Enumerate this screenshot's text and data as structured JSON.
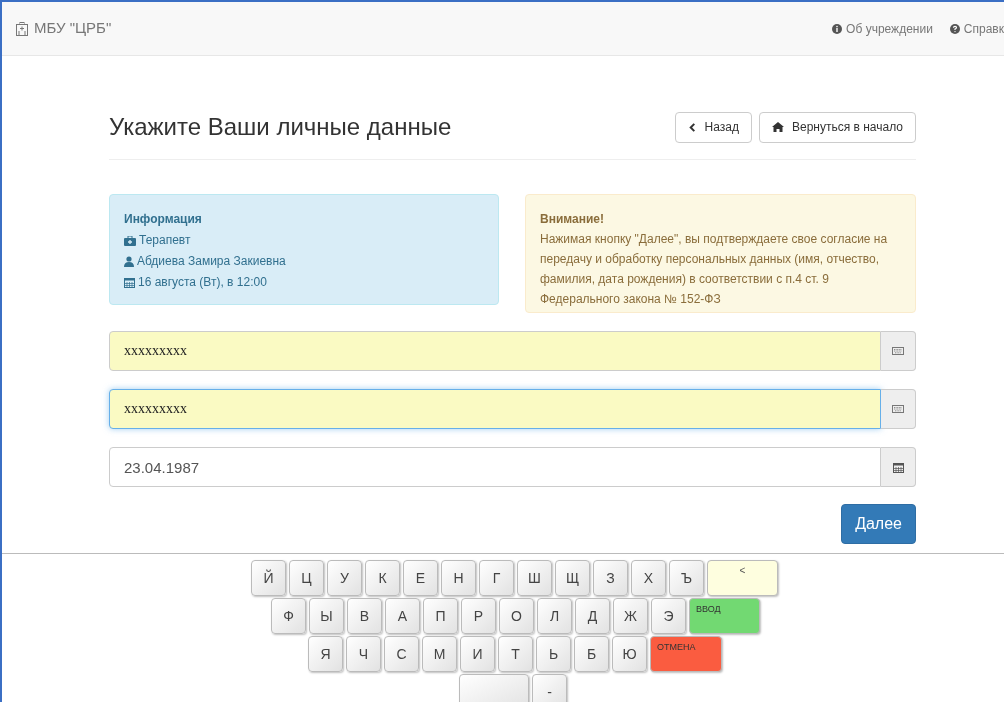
{
  "navbar": {
    "brand": "МБУ \"ЦРБ\"",
    "links": [
      {
        "label": "Об учреждении",
        "kind": "info"
      },
      {
        "label": "Справк",
        "kind": "question"
      }
    ]
  },
  "header": {
    "title": "Укажите Ваши личные данные",
    "buttons": [
      {
        "label": "Назад",
        "kind": "back"
      },
      {
        "label": "Вернуться в начало",
        "kind": "home"
      }
    ]
  },
  "info": {
    "title": "Информация",
    "items": [
      {
        "kind": "medkit",
        "text": "Терапевт"
      },
      {
        "kind": "user",
        "text": "Абдиева Замира Закиевна"
      },
      {
        "kind": "calendar",
        "text": "16 августа (Вт), в 12:00"
      }
    ]
  },
  "warning": {
    "title": "Внимание!",
    "text": "Нажимая кнопку \"Далее\", вы подтверждаете свое согласие на передачу и обработку персональных данных (имя, отчество, фамилия, дата рождения) в соответствии с п.4 ст. 9 Федерального закона № 152-ФЗ"
  },
  "fields": [
    {
      "value": "xxxxxxxxx",
      "autofilled": true,
      "focused": false,
      "kind": "keyboard"
    },
    {
      "value": "xxxxxxxxx",
      "autofilled": true,
      "focused": true,
      "kind": "keyboard"
    },
    {
      "value": "23.04.1987",
      "autofilled": false,
      "focused": false,
      "kind": "calendar"
    }
  ],
  "submit": "Далее",
  "keyboard": [
    [
      {
        "kind": "letter",
        "label": "Й"
      },
      {
        "kind": "letter",
        "label": "Ц"
      },
      {
        "kind": "letter",
        "label": "У"
      },
      {
        "kind": "letter",
        "label": "К"
      },
      {
        "kind": "letter",
        "label": "Е"
      },
      {
        "kind": "letter",
        "label": "Н"
      },
      {
        "kind": "letter",
        "label": "Г"
      },
      {
        "kind": "letter",
        "label": "Ш"
      },
      {
        "kind": "letter",
        "label": "Щ"
      },
      {
        "kind": "letter",
        "label": "З"
      },
      {
        "kind": "letter",
        "label": "Х"
      },
      {
        "kind": "letter",
        "label": "Ъ"
      },
      {
        "kind": "backspace",
        "label": "<"
      }
    ],
    [
      {
        "kind": "letter",
        "label": "Ф"
      },
      {
        "kind": "letter",
        "label": "Ы"
      },
      {
        "kind": "letter",
        "label": "В"
      },
      {
        "kind": "letter",
        "label": "А"
      },
      {
        "kind": "letter",
        "label": "П"
      },
      {
        "kind": "letter",
        "label": "Р"
      },
      {
        "kind": "letter",
        "label": "О"
      },
      {
        "kind": "letter",
        "label": "Л"
      },
      {
        "kind": "letter",
        "label": "Д"
      },
      {
        "kind": "letter",
        "label": "Ж"
      },
      {
        "kind": "letter",
        "label": "Э"
      },
      {
        "kind": "enter",
        "label": "ВВОД"
      }
    ],
    [
      {
        "kind": "letter",
        "label": "Я"
      },
      {
        "kind": "letter",
        "label": "Ч"
      },
      {
        "kind": "letter",
        "label": "С"
      },
      {
        "kind": "letter",
        "label": "М"
      },
      {
        "kind": "letter",
        "label": "И"
      },
      {
        "kind": "letter",
        "label": "Т"
      },
      {
        "kind": "letter",
        "label": "Ь"
      },
      {
        "kind": "letter",
        "label": "Б"
      },
      {
        "kind": "letter",
        "label": "Ю"
      },
      {
        "kind": "cancel",
        "label": "ОТМЕНА"
      }
    ],
    [
      {
        "kind": "space"
      },
      {
        "kind": "letter",
        "label": "-"
      }
    ]
  ]
}
